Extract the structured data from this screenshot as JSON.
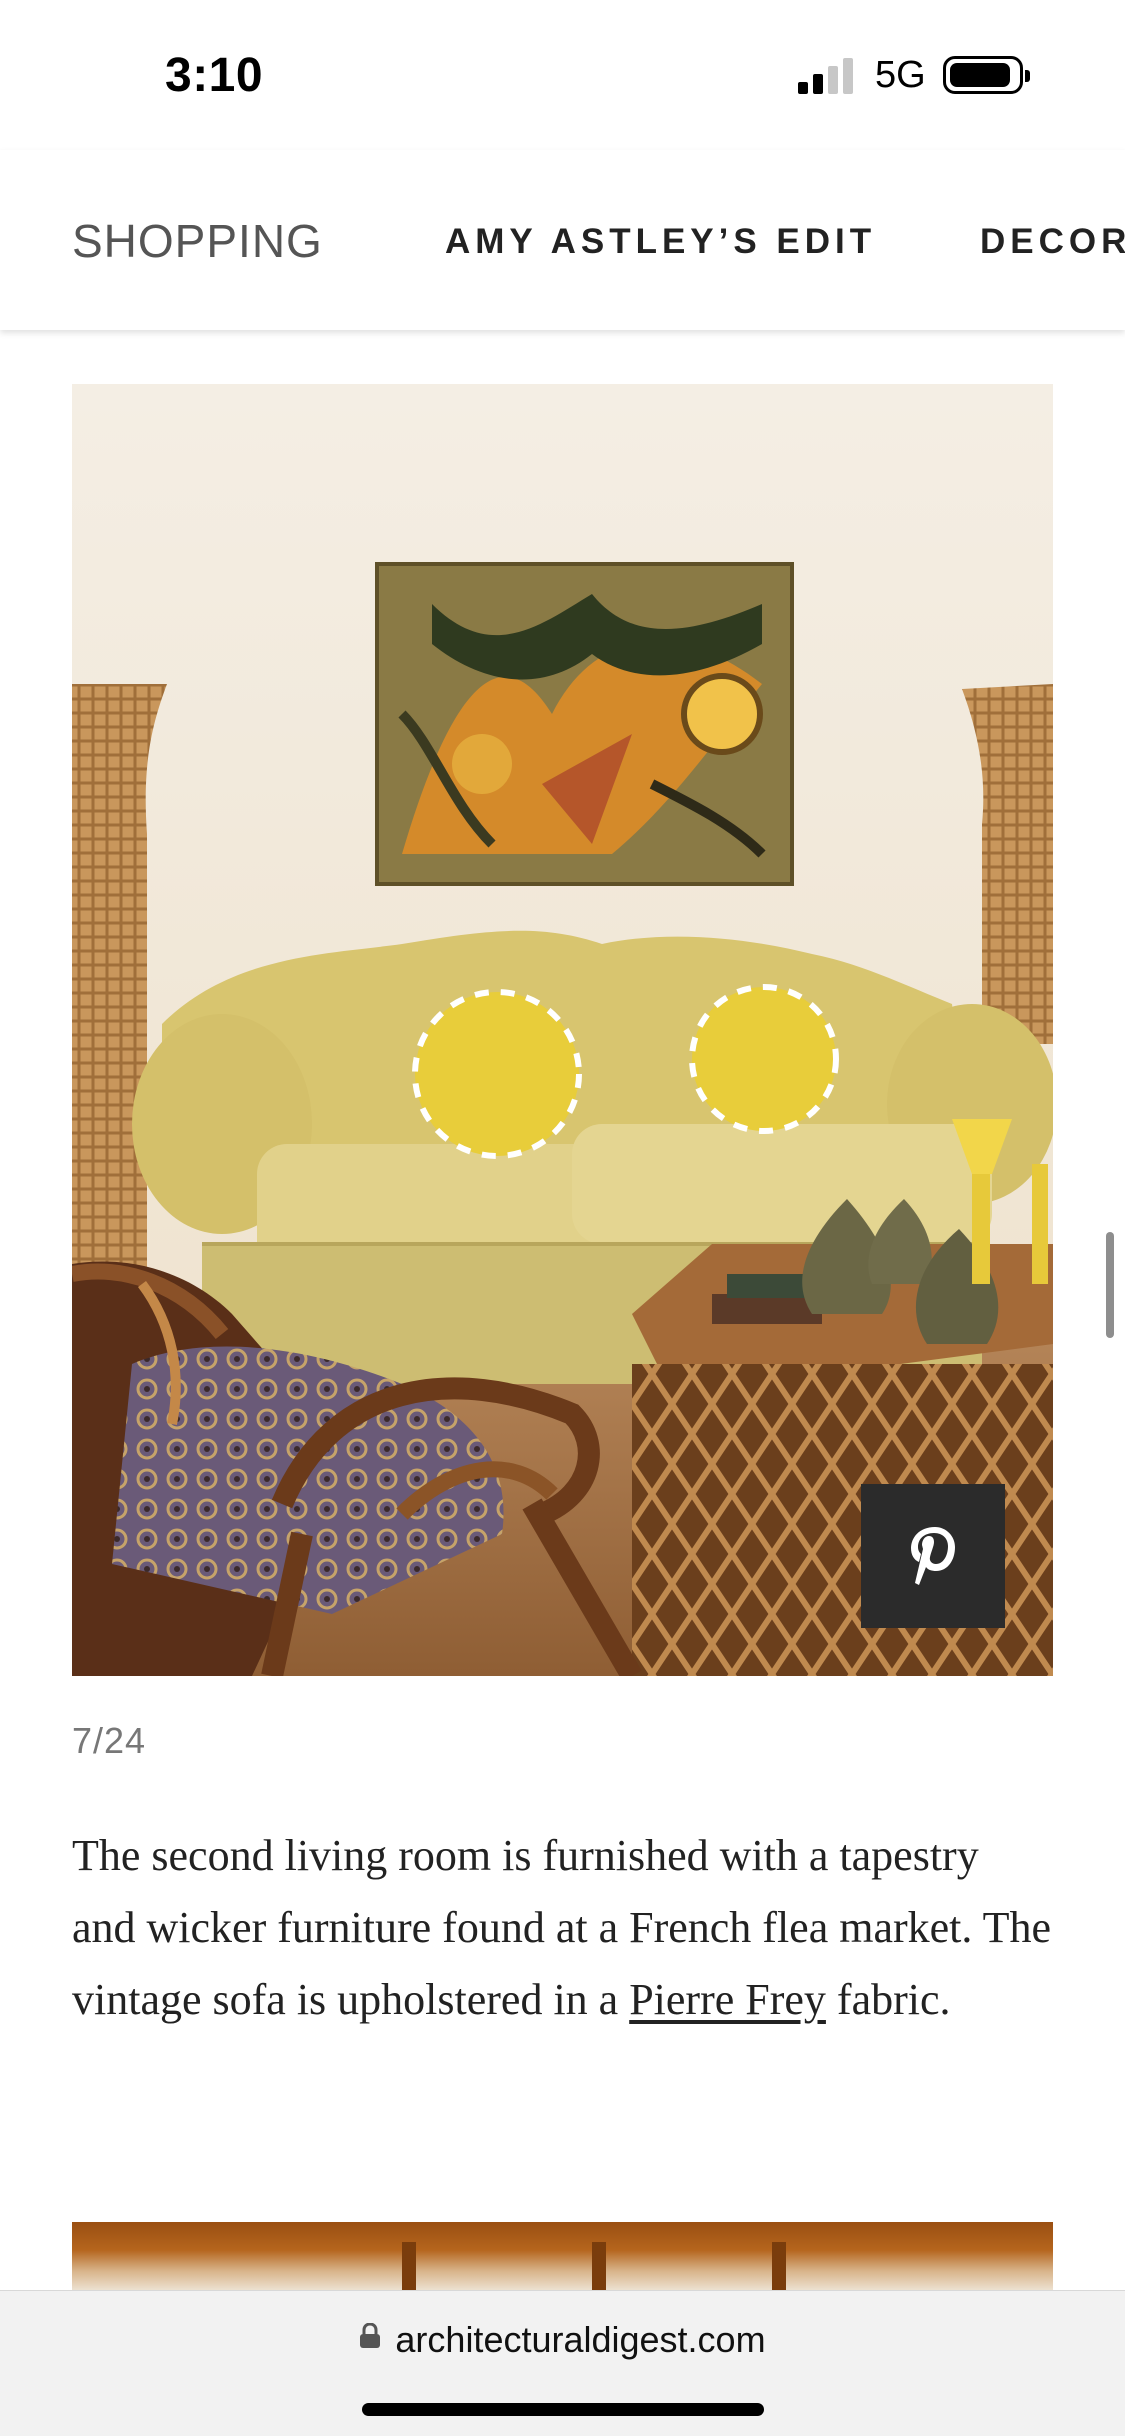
{
  "status_bar": {
    "time": "3:10",
    "network": "5G",
    "signal_icon": "cellular-signal-icon",
    "battery_icon": "battery-icon"
  },
  "nav": {
    "items": [
      {
        "label": "SHOPPING"
      },
      {
        "label": "AMY ASTLEY’S EDIT"
      },
      {
        "label": "DECOR"
      }
    ]
  },
  "slide": {
    "counter": "7/24",
    "caption_part1": "The second living room is furnished with a tapestry and wicker furniture found at a French flea market. The vintage sofa is upholstered in a ",
    "caption_link": "Pierre Frey",
    "caption_part2": " fabric.",
    "pin_icon": "pinterest-icon"
  },
  "browser": {
    "url": "architecturaldigest.com",
    "lock_icon": "lock-icon"
  },
  "colors": {
    "pin_button_bg": "#2b2b2b",
    "sofa": "#d9c77c",
    "wall": "#f3ece0",
    "wicker": "#b9864a"
  }
}
